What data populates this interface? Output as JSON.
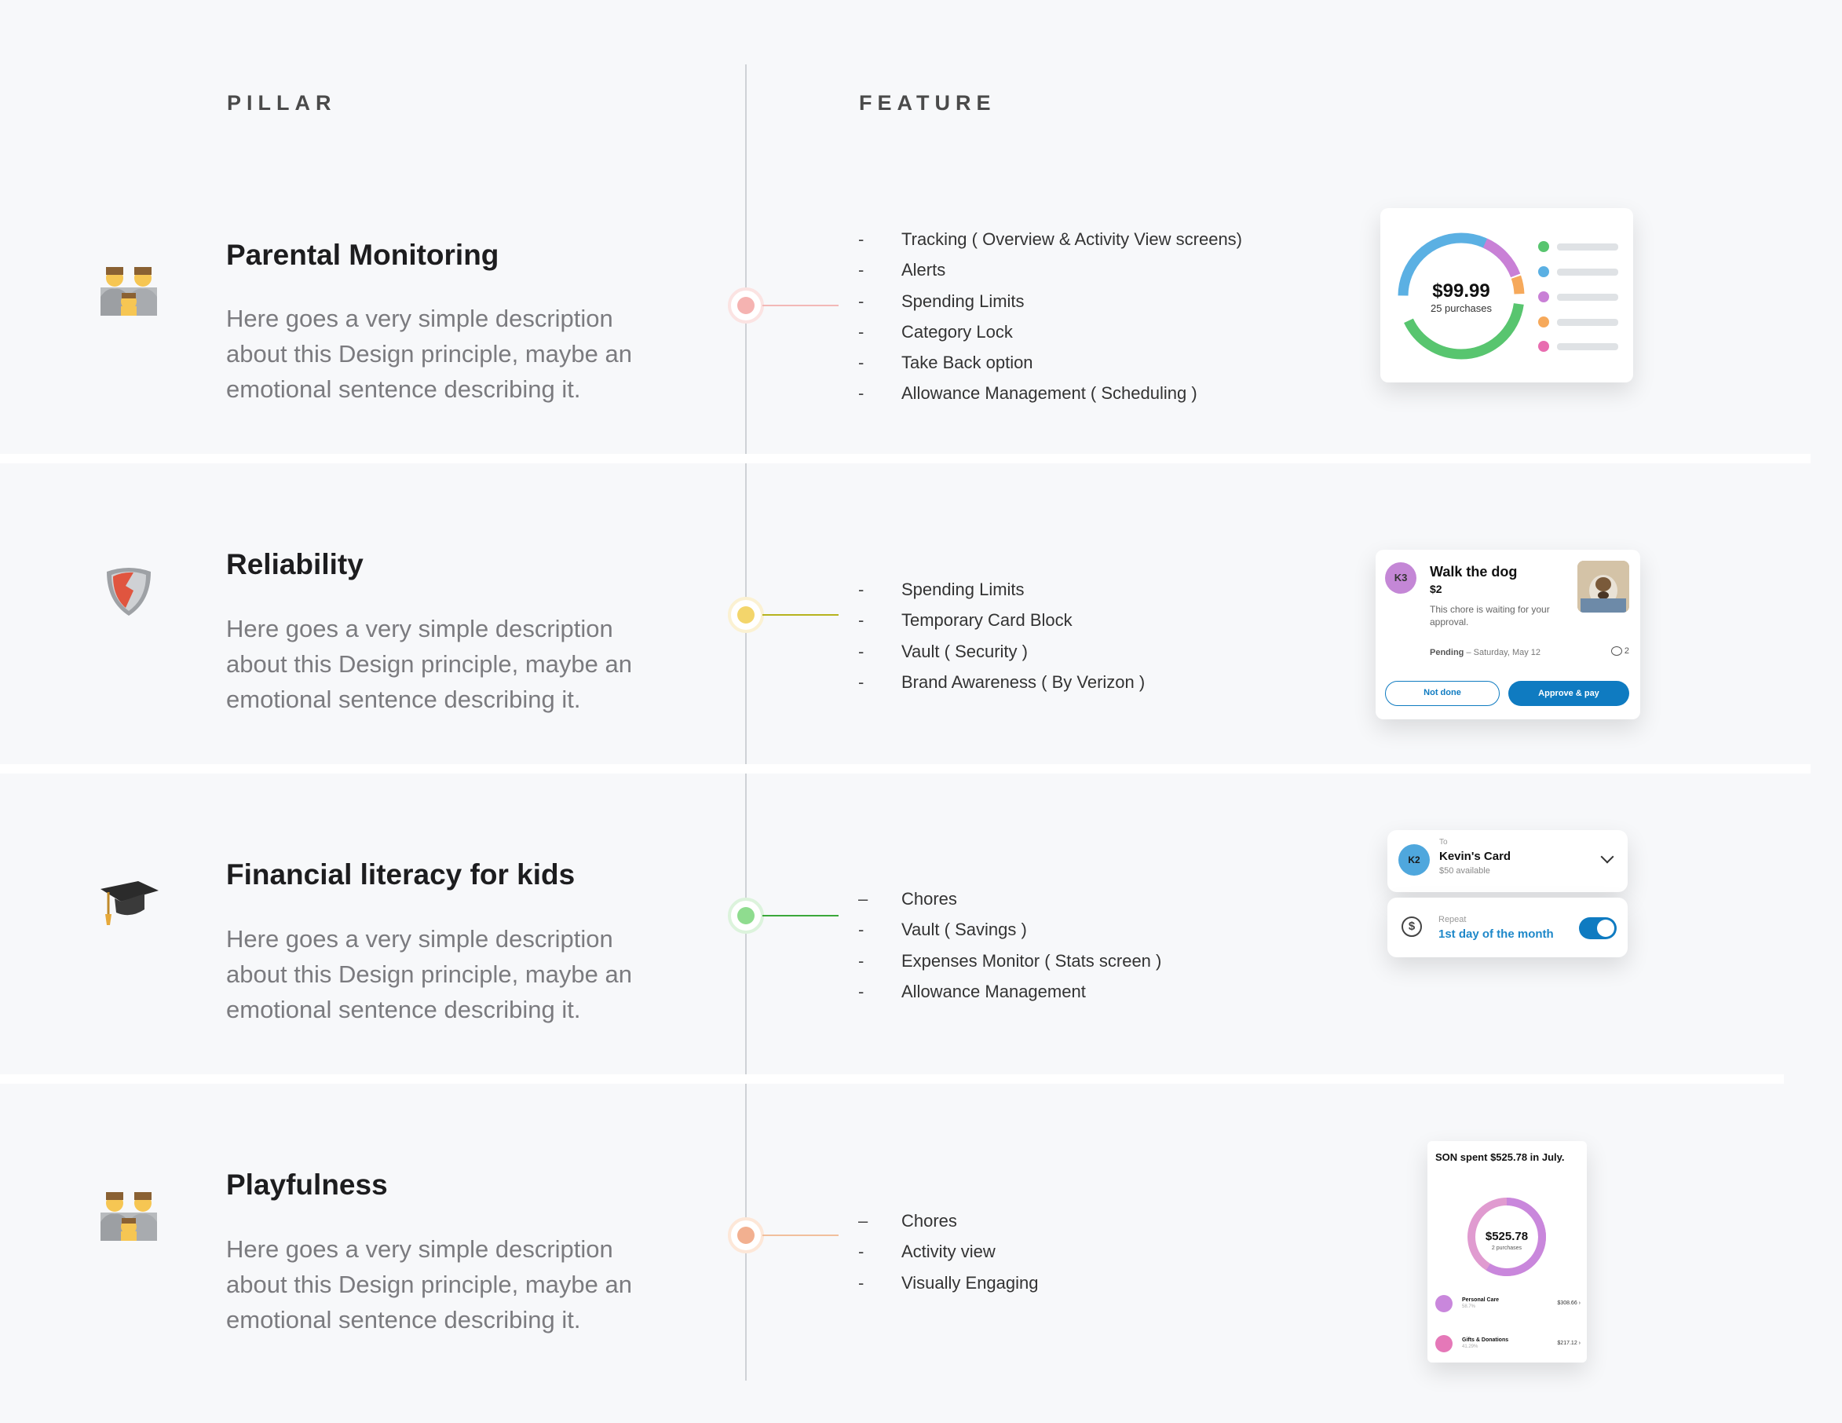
{
  "header": {
    "pillar": "PILLAR",
    "feature": "FEATURE"
  },
  "colors": {
    "background": "#f7f8fa",
    "pink": "#f4a8a8",
    "yellow": "#f3d56b",
    "green": "#6cc96c",
    "orange": "#f0a677",
    "blue_button": "#0f7bc1"
  },
  "pillars": [
    {
      "icon": "family-icon",
      "title": "Parental Monitoring",
      "desc": [
        "Here goes a very simple description",
        "about this Design principle, maybe an",
        "emotional sentence describing it."
      ],
      "dot_color": "#f5b3b1",
      "line_color": "#f2b8b6",
      "features": [
        "Tracking ( Overview & Activity View screens)",
        "Alerts",
        "Spending Limits",
        "Category Lock",
        "Take Back option",
        "Allowance Management ( Scheduling )"
      ],
      "card": {
        "amount": "$99.99",
        "sub": "25 purchases",
        "legend_colors": [
          "#58c56f",
          "#5bb0e3",
          "#c980d6",
          "#f6a95b",
          "#e86db0"
        ]
      }
    },
    {
      "icon": "shield-icon",
      "title": "Reliability",
      "desc": [
        "Here goes a very simple description",
        "about this Design principle, maybe an",
        "emotional sentence describing it."
      ],
      "dot_color": "#f3d56b",
      "line_color": "#b6b31e",
      "features": [
        "Spending Limits",
        "Temporary Card Block",
        "Vault ( Security )",
        "Brand Awareness ( By Verizon )"
      ],
      "card": {
        "avatar": "K3",
        "title": "Walk the dog",
        "price": "$2",
        "note": "This chore is waiting for your approval.",
        "status_label": "Pending",
        "status_date": " – Saturday, May 12",
        "comments": "2",
        "btn_secondary": "Not done",
        "btn_primary": "Approve & pay"
      }
    },
    {
      "icon": "graduation-cap-icon",
      "title": "Financial literacy for kids",
      "desc": [
        "Here goes a very simple description",
        "about this Design principle, maybe an",
        "emotional sentence describing it."
      ],
      "dot_color": "#8fdc8f",
      "line_color": "#3aa83a",
      "features": [
        "Chores",
        "Vault ( Savings )",
        "Expenses Monitor ( Stats screen )",
        "Allowance Management"
      ],
      "dashes": [
        "–",
        "-",
        "-",
        "-"
      ],
      "card": {
        "to_label": "To",
        "avatar": "K2",
        "card_name": "Kevin's Card",
        "available": "$50 available",
        "repeat_label": "Repeat",
        "repeat_value": "1st day of the month",
        "toggle_on": true
      }
    },
    {
      "icon": "family-icon",
      "title": "Playfulness",
      "desc": [
        "Here goes a very simple description",
        "about this Design principle, maybe an",
        "emotional sentence describing it."
      ],
      "dot_color": "#f2b090",
      "line_color": "#f1bf9c",
      "features": [
        "Chores",
        "Activity view",
        "Visually Engaging"
      ],
      "dashes": [
        "–",
        "-",
        "-"
      ],
      "card": {
        "headline": "SON spent $525.78 in July.",
        "amount": "$525.78",
        "sub": "2 purchases",
        "rows": [
          {
            "name": "Personal Care",
            "pct": "58.7%",
            "value": "$308.66"
          },
          {
            "name": "Gifts & Donations",
            "pct": "41.29%",
            "value": "$217.12"
          }
        ]
      }
    }
  ]
}
